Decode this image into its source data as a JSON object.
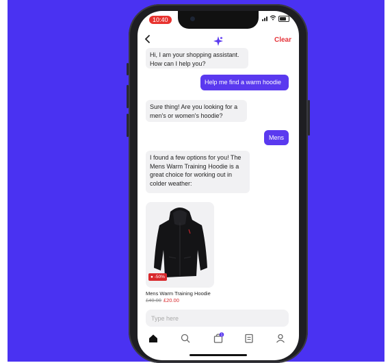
{
  "status": {
    "time": "10:40"
  },
  "header": {
    "clear_label": "Clear",
    "back_icon": "chevron-left-icon",
    "logo_icon": "sparkle-logo-icon",
    "accent": "#5a39ef",
    "clear_color": "#e5333a"
  },
  "messages": [
    {
      "from": "bot",
      "lines": [
        "Hi, I am your shopping assistant.",
        "How can I help you?"
      ]
    },
    {
      "from": "user",
      "lines": [
        "Help me find a warm hoodie"
      ]
    },
    {
      "from": "bot",
      "lines": [
        "Sure thing! Are you looking for a",
        "men's or women's hoodie?"
      ]
    },
    {
      "from": "user",
      "lines": [
        "Mens"
      ]
    },
    {
      "from": "bot",
      "lines": [
        "I found a few options for you! The",
        "Mens Warm Training Hoodie is a",
        "great choice for working out in",
        "colder weather:"
      ]
    }
  ],
  "product": {
    "badge": "-50%",
    "name": "Mens Warm Training Hoodie",
    "old_price": "£40.00",
    "new_price": "£20.00"
  },
  "composer": {
    "placeholder": "Type here"
  },
  "tabbar": {
    "icons": [
      "home-icon",
      "search-icon",
      "bag-icon",
      "orders-icon",
      "account-icon"
    ],
    "cart_count": "1"
  },
  "colors": {
    "background": "#4a32f2",
    "user_bubble": "#5a39ef",
    "bot_bubble": "#f1f1f3",
    "sale": "#d8282c"
  }
}
